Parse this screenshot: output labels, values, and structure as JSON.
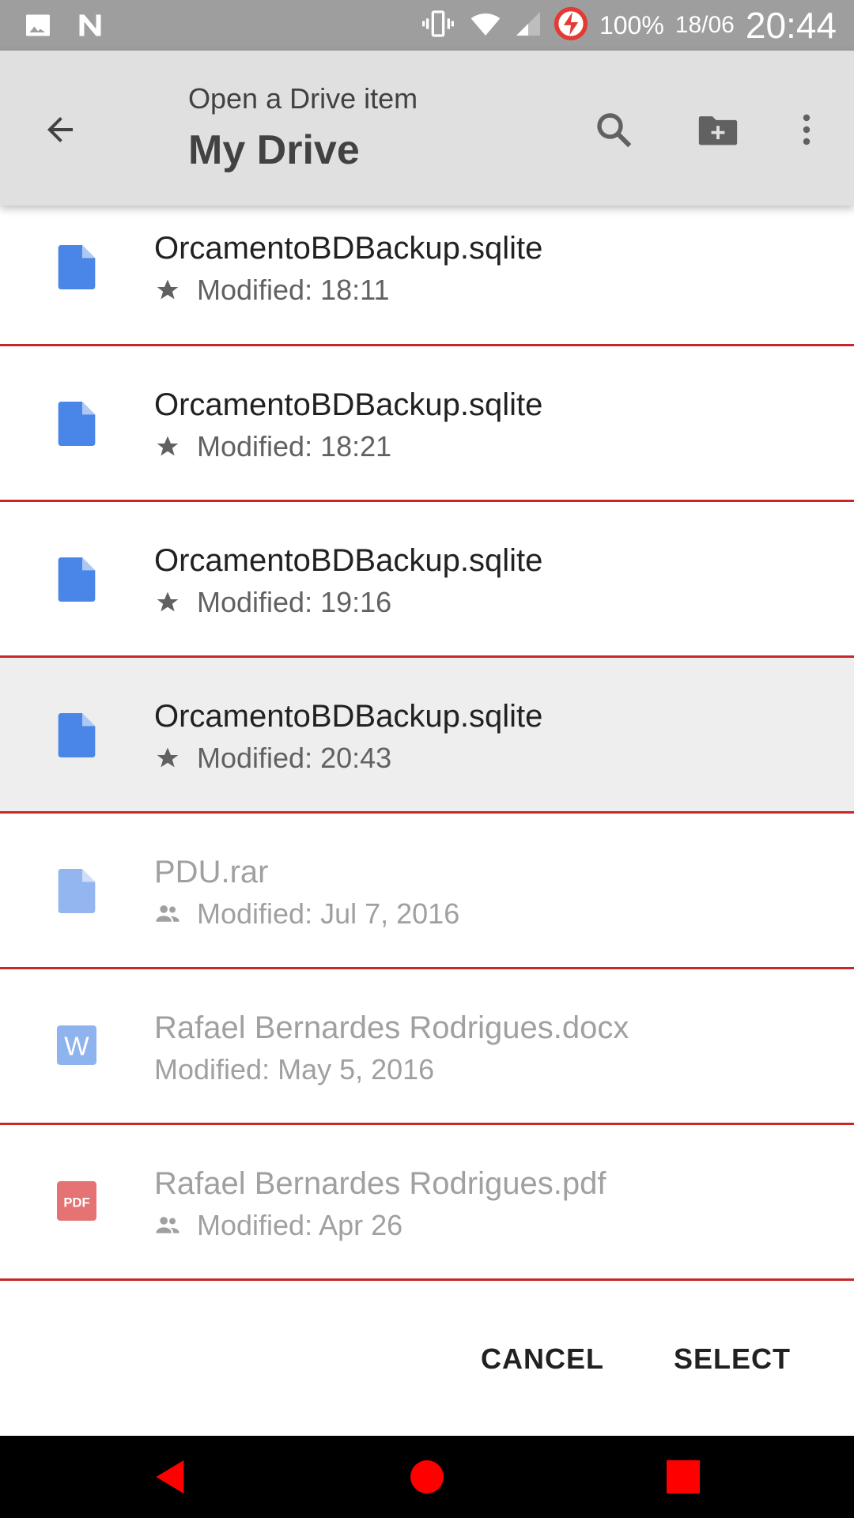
{
  "status_bar": {
    "battery_percent": "100%",
    "date": "18/06",
    "time": "20:44"
  },
  "app_bar": {
    "subtitle": "Open a Drive item",
    "title": "My Drive"
  },
  "files": [
    {
      "name": "OrcamentoBDBackup.sqlite",
      "modified": "Modified: 18:11",
      "meta_icon": "star-icon",
      "file_icon": "doc-icon",
      "selected": false,
      "disabled": false
    },
    {
      "name": "OrcamentoBDBackup.sqlite",
      "modified": "Modified: 18:21",
      "meta_icon": "star-icon",
      "file_icon": "doc-icon",
      "selected": false,
      "disabled": false
    },
    {
      "name": "OrcamentoBDBackup.sqlite",
      "modified": "Modified: 19:16",
      "meta_icon": "star-icon",
      "file_icon": "doc-icon",
      "selected": false,
      "disabled": false
    },
    {
      "name": "OrcamentoBDBackup.sqlite",
      "modified": "Modified: 20:43",
      "meta_icon": "star-icon",
      "file_icon": "doc-icon",
      "selected": true,
      "disabled": false
    },
    {
      "name": "PDU.rar",
      "modified": "Modified: Jul 7, 2016",
      "meta_icon": "shared-icon",
      "file_icon": "doc-icon",
      "selected": false,
      "disabled": true
    },
    {
      "name": "Rafael Bernardes Rodrigues.docx",
      "modified": "Modified: May 5, 2016",
      "meta_icon": "",
      "file_icon": "word-icon",
      "file_icon_label": "W",
      "selected": false,
      "disabled": true
    },
    {
      "name": "Rafael Bernardes Rodrigues.pdf",
      "modified": "Modified: Apr 26",
      "meta_icon": "shared-icon",
      "file_icon": "pdf-icon",
      "file_icon_label": "PDF",
      "selected": false,
      "disabled": true
    }
  ],
  "actions": {
    "cancel_label": "CANCEL",
    "select_label": "SELECT"
  },
  "colors": {
    "status_bar": "#9e9e9e",
    "app_bar": "#e0e0e0",
    "divider": "#c62828",
    "doc_blue": "#4a86e8",
    "pdf_red": "#e57373",
    "nav_red": "#ff0000"
  }
}
